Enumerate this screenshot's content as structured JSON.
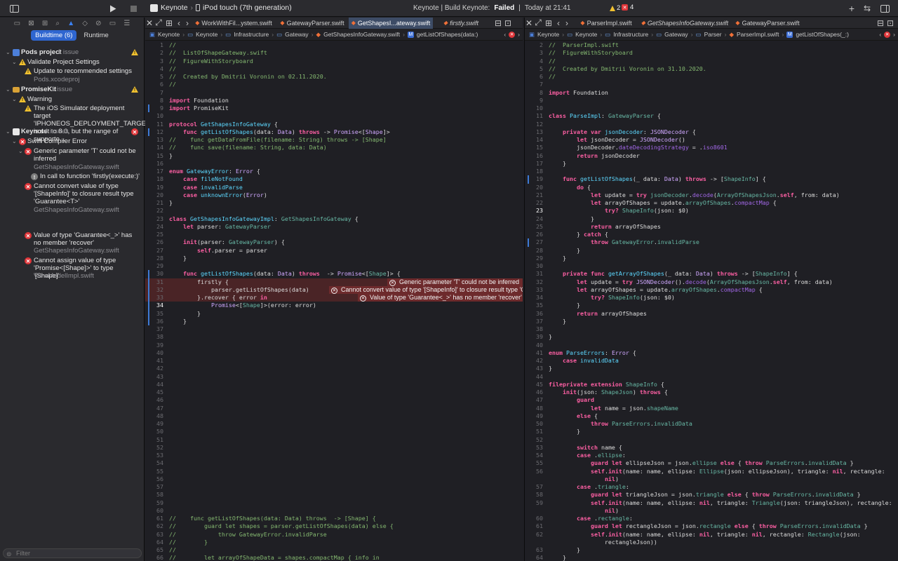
{
  "toolbar": {
    "scheme": "Keynote",
    "device": "iPod touch (7th generation)",
    "status_prefix": "Keynote | Build Keynote:",
    "status_result": "Failed",
    "status_time": "Today at 21:41",
    "warning_count": "2",
    "error_count": "4"
  },
  "navigator": {
    "segments": [
      "Buildtime (6)",
      "Runtime"
    ],
    "filter_placeholder": "Filter",
    "items": {
      "pods_title": "Pods project",
      "pods_count": "1 issue",
      "pods_group": "Validate Project Settings",
      "pods_issue": "Update to recommended settings",
      "pods_file": "Pods.xcodeproj",
      "promise_title": "PromiseKit",
      "promise_count": "1 issue",
      "promise_group": "Warning",
      "promise_issue": "The iOS Simulator deployment target 'IPHONEOS_DEPLOYMENT_TARGET' is set to 8.0, but the range of supporte...",
      "keynote_title": "Keynote",
      "keynote_count": "4 issues",
      "keynote_group": "Swift Compiler Error",
      "err1": "Generic parameter 'T' could not be inferred",
      "err1_file": "GetShapesInfoGateway.swift",
      "note1": "In call to function 'firstly(execute:)'",
      "err2": "Cannot convert value of type '[ShapeInfo]' to closure result type 'Guarantee<T>'",
      "err2_file": "GetShapesInfoGateway.swift",
      "err3": "Value of type 'Guarantee<_>' has no member 'recover'",
      "err3_file": "GetShapesInfoGateway.swift",
      "err4": "Cannot assign value of type 'Promise<[Shape]>' to type '[Shape]'",
      "err4_file": "ViewModelImpl.swift"
    }
  },
  "left_editor": {
    "tabs": [
      "WorkWithFil...ystem.swift",
      "GatewayParser.swift",
      "GetShapesI...ateway.swift",
      "firstly.swift"
    ],
    "active_tab": "GetShapesI...ateway.swift",
    "breadcrumb": [
      "Keynote",
      "Keynote",
      "Infrastructure",
      "Gateway",
      "GetShapesInfoGateway.swift",
      "getListOfShapes(data:)"
    ],
    "inline_errors": [
      "Generic parameter 'T' could not be inferred",
      "Cannot convert value of type '[ShapeInfo]' to closure result type 'Gu...",
      "Value of type 'Guarantee<_>' has no member 'recover'"
    ]
  },
  "right_editor": {
    "tabs": [
      "ParserImpl.swift",
      "GetShapesInfoGateway.swift",
      "GatewayParser.swift"
    ],
    "active_tab": "ParserImpl.swift",
    "breadcrumb": [
      "Keynote",
      "Keynote",
      "Infrastructure",
      "Gateway",
      "Parser",
      "ParserImpl.swift",
      "getListOfShapes(_:)"
    ]
  },
  "left_code": [
    {
      "n": "1",
      "html": "<span class='cmt'>//</span>"
    },
    {
      "n": "2",
      "html": "<span class='cmt'>//  ListOfShapeGateway.swift</span>"
    },
    {
      "n": "3",
      "html": "<span class='cmt'>//  FigureWithStoryboard</span>"
    },
    {
      "n": "4",
      "html": "<span class='cmt'>//</span>"
    },
    {
      "n": "5",
      "html": "<span class='cmt'>//  Created by Dmitrii Voronin on 02.11.2020.</span>"
    },
    {
      "n": "6",
      "html": "<span class='cmt'>//</span>"
    },
    {
      "n": "7",
      "html": ""
    },
    {
      "n": "8",
      "html": "<span class='k'>import</span> Foundation"
    },
    {
      "n": "9",
      "html": "<span class='k'>import</span> PromiseKit"
    },
    {
      "n": "10",
      "html": ""
    },
    {
      "n": "11",
      "html": "<span class='k'>protocol</span> <span class='t'>GetShapesInfoGateway</span> {"
    },
    {
      "n": "12",
      "html": "    <span class='k'>func</span> <span class='t'>getListOfShapes</span>(data: <span class='ty'>Data</span>) <span class='k'>throws</span> -> <span class='ty'>Promise</span>&lt;[<span class='ty'>Shape</span>]&gt;"
    },
    {
      "n": "13",
      "html": "<span class='cmt'>//    func getDataFromFile(filename: String) throws -> [Shape]</span>"
    },
    {
      "n": "14",
      "html": "<span class='cmt'>//    func save(filename: String, data: Data)</span>"
    },
    {
      "n": "15",
      "html": "}"
    },
    {
      "n": "16",
      "html": ""
    },
    {
      "n": "17",
      "html": "<span class='k'>enum</span> <span class='t'>GatewayError</span>: <span class='ty'>Error</span> {"
    },
    {
      "n": "18",
      "html": "    <span class='k'>case</span> <span class='t'>fileNotFound</span>"
    },
    {
      "n": "19",
      "html": "    <span class='k'>case</span> <span class='t'>invalidParse</span>"
    },
    {
      "n": "20",
      "html": "    <span class='k'>case</span> <span class='t'>unknownError</span>(<span class='ty'>Error</span>)"
    },
    {
      "n": "21",
      "html": "}"
    },
    {
      "n": "22",
      "html": ""
    },
    {
      "n": "23",
      "html": "<span class='k'>class</span> <span class='t'>GetShapesInfoGatewayImpl</span>: <span class='f'>GetShapesInfoGateway</span> {"
    },
    {
      "n": "24",
      "html": "    <span class='k'>let</span> parser: <span class='f'>GatewayParser</span>"
    },
    {
      "n": "25",
      "html": ""
    },
    {
      "n": "26",
      "html": "    <span class='k'>init</span>(parser: <span class='f'>GatewayParser</span>) {"
    },
    {
      "n": "27",
      "html": "        <span class='k'>self</span>.parser = parser"
    },
    {
      "n": "28",
      "html": "    }"
    },
    {
      "n": "29",
      "html": ""
    },
    {
      "n": "30",
      "html": "    <span class='k'>func</span> <span class='t'>getListOfShapes</span>(data: <span class='ty'>Data</span>) <span class='k'>throws</span>  -> <span class='ty'>Promise</span>&lt;[<span class='f'>Shape</span>]&gt; {"
    },
    {
      "n": "31",
      "html": "        firstly {"
    },
    {
      "n": "32",
      "html": "            parser.getListOfShapes(data)"
    },
    {
      "n": "33",
      "html": "        }.recover { error <span class='k'>in</span>"
    },
    {
      "n": "34",
      "html": "            <span class='ty'>Promise</span>&lt;[<span class='f'>Shape</span>]&gt;(error: error)"
    },
    {
      "n": "35",
      "html": "        }"
    },
    {
      "n": "36",
      "html": "    }"
    },
    {
      "n": "37",
      "html": ""
    },
    {
      "n": "38",
      "html": ""
    },
    {
      "n": "39",
      "html": ""
    },
    {
      "n": "40",
      "html": ""
    },
    {
      "n": "41",
      "html": ""
    },
    {
      "n": "42",
      "html": ""
    },
    {
      "n": "43",
      "html": ""
    },
    {
      "n": "44",
      "html": ""
    },
    {
      "n": "45",
      "html": ""
    },
    {
      "n": "46",
      "html": ""
    },
    {
      "n": "47",
      "html": ""
    },
    {
      "n": "48",
      "html": ""
    },
    {
      "n": "49",
      "html": ""
    },
    {
      "n": "50",
      "html": ""
    },
    {
      "n": "51",
      "html": ""
    },
    {
      "n": "52",
      "html": ""
    },
    {
      "n": "53",
      "html": ""
    },
    {
      "n": "54",
      "html": ""
    },
    {
      "n": "55",
      "html": ""
    },
    {
      "n": "56",
      "html": ""
    },
    {
      "n": "57",
      "html": ""
    },
    {
      "n": "58",
      "html": ""
    },
    {
      "n": "59",
      "html": ""
    },
    {
      "n": "60",
      "html": ""
    },
    {
      "n": "61",
      "html": "<span class='cmt'>//    func getListOfShapes(data: Data) throws  -> [Shape] {</span>"
    },
    {
      "n": "62",
      "html": "<span class='cmt'>//        guard let shapes = parser.getListOfShapes(data) else {</span>"
    },
    {
      "n": "63",
      "html": "<span class='cmt'>//            throw GatewayError.invalidParse</span>"
    },
    {
      "n": "64",
      "html": "<span class='cmt'>//        }</span>"
    },
    {
      "n": "65",
      "html": "<span class='cmt'>//</span>"
    },
    {
      "n": "66",
      "html": "<span class='cmt'>//        let arrayOfShapeData = shapes.compactMap { info in</span>"
    }
  ],
  "right_code": [
    {
      "n": "2",
      "html": "<span class='cmt'>//  ParserImpl.swift</span>"
    },
    {
      "n": "3",
      "html": "<span class='cmt'>//  FigureWithStoryboard</span>"
    },
    {
      "n": "4",
      "html": "<span class='cmt'>//</span>"
    },
    {
      "n": "5",
      "html": "<span class='cmt'>//  Created by Dmitrii Voronin on 31.10.2020.</span>"
    },
    {
      "n": "6",
      "html": "<span class='cmt'>//</span>"
    },
    {
      "n": "7",
      "html": ""
    },
    {
      "n": "8",
      "html": "<span class='k'>import</span> Foundation"
    },
    {
      "n": "9",
      "html": ""
    },
    {
      "n": "10",
      "html": ""
    },
    {
      "n": "11",
      "html": "<span class='k'>class</span> <span class='t'>ParseImpl</span>: <span class='f'>GatewayParser</span> {"
    },
    {
      "n": "12",
      "html": ""
    },
    {
      "n": "13",
      "html": "    <span class='k'>private var</span> <span class='t'>jsonDecoder</span>: <span class='ty'>JSONDecoder</span> {"
    },
    {
      "n": "14",
      "html": "        <span class='k'>let</span> jsonDecoder = <span class='ty'>JSONDecoder</span>()"
    },
    {
      "n": "15",
      "html": "        jsonDecoder.<span class='m'>dateDecodingStrategy</span> = .<span class='m'>iso8601</span>"
    },
    {
      "n": "16",
      "html": "        <span class='k'>return</span> jsonDecoder"
    },
    {
      "n": "17",
      "html": "    }"
    },
    {
      "n": "18",
      "html": ""
    },
    {
      "n": "19",
      "html": "    <span class='k'>func</span> <span class='t'>getListOfShapes</span>(_ data: <span class='ty'>Data</span>) <span class='k'>throws</span> -> [<span class='f'>ShapeInfo</span>] {"
    },
    {
      "n": "20",
      "html": "        <span class='k'>do</span> {"
    },
    {
      "n": "21",
      "html": "            <span class='k'>let</span> update = <span class='k'>try</span> <span class='f'>jsonDecoder</span>.<span class='m'>decode</span>(<span class='f'>ArrayOfShapesJson</span>.<span class='k'>self</span>, from: data)"
    },
    {
      "n": "22",
      "html": "            <span class='k'>let</span> arrayOfShapes = update.<span class='f'>arrayOfShapes</span>.<span class='m'>compactMap</span> {"
    },
    {
      "n": "23",
      "html": "                <span class='k'>try?</span> <span class='f'>ShapeInfo</span>(json: $0)"
    },
    {
      "n": "24",
      "html": "            }"
    },
    {
      "n": "25",
      "html": "            <span class='k'>return</span> arrayOfShapes"
    },
    {
      "n": "26",
      "html": "        } <span class='k'>catch</span> {"
    },
    {
      "n": "27",
      "html": "            <span class='k'>throw</span> <span class='f'>GatewayError</span>.<span class='f'>invalidParse</span>"
    },
    {
      "n": "28",
      "html": "        }"
    },
    {
      "n": "29",
      "html": "    }"
    },
    {
      "n": "30",
      "html": ""
    },
    {
      "n": "31",
      "html": "    <span class='k'>private func</span> <span class='t'>getArrayOfShapes</span>(_ data: <span class='ty'>Data</span>) <span class='k'>throws</span> -> [<span class='f'>ShapeInfo</span>] {"
    },
    {
      "n": "32",
      "html": "        <span class='k'>let</span> update = <span class='k'>try</span> <span class='ty'>JSONDecoder</span>().<span class='m'>decode</span>(<span class='f'>ArrayOfShapesJson</span>.<span class='k'>self</span>, from: data)"
    },
    {
      "n": "33",
      "html": "        <span class='k'>let</span> arrayOfShapes = update.<span class='f'>arrayOfShapes</span>.<span class='m'>compactMap</span> {"
    },
    {
      "n": "34",
      "html": "            <span class='k'>try?</span> <span class='f'>ShapeInfo</span>(json: $0)"
    },
    {
      "n": "35",
      "html": "        }"
    },
    {
      "n": "36",
      "html": "        <span class='k'>return</span> arrayOfShapes"
    },
    {
      "n": "37",
      "html": "    }"
    },
    {
      "n": "38",
      "html": ""
    },
    {
      "n": "39",
      "html": "}"
    },
    {
      "n": "40",
      "html": ""
    },
    {
      "n": "41",
      "html": "<span class='k'>enum</span> <span class='t'>ParseErrors</span>: <span class='ty'>Error</span> {"
    },
    {
      "n": "42",
      "html": "    <span class='k'>case</span> <span class='t'>invalidData</span>"
    },
    {
      "n": "43",
      "html": "}"
    },
    {
      "n": "44",
      "html": ""
    },
    {
      "n": "45",
      "html": "<span class='k'>fileprivate extension</span> <span class='f'>ShapeInfo</span> {"
    },
    {
      "n": "46",
      "html": "    <span class='k'>init</span>(json: <span class='f'>ShapeJson</span>) <span class='k'>throws</span> {"
    },
    {
      "n": "47",
      "html": "        <span class='k'>guard</span>"
    },
    {
      "n": "48",
      "html": "            <span class='k'>let</span> name = json.<span class='f'>shapeName</span>"
    },
    {
      "n": "49",
      "html": "        <span class='k'>else</span> {"
    },
    {
      "n": "50",
      "html": "            <span class='k'>throw</span> <span class='f'>ParseErrors</span>.<span class='f'>invalidData</span>"
    },
    {
      "n": "51",
      "html": "        }"
    },
    {
      "n": "52",
      "html": ""
    },
    {
      "n": "53",
      "html": "        <span class='k'>switch</span> name {"
    },
    {
      "n": "54",
      "html": "        <span class='k'>case</span> .<span class='f'>ellipse</span>:"
    },
    {
      "n": "55",
      "html": "            <span class='k'>guard let</span> ellipseJson = json.<span class='f'>ellipse</span> <span class='k'>else</span> { <span class='k'>throw</span> <span class='f'>ParseErrors</span>.<span class='f'>invalidData</span> }"
    },
    {
      "n": "56",
      "html": "            <span class='k'>self</span>.<span class='k'>init</span>(name: name, ellipse: <span class='f'>Ellipse</span>(json: ellipseJson), triangle: <span class='k'>nil</span>, rectangle:"
    },
    {
      "n": "",
      "html": "                <span class='k'>nil</span>)"
    },
    {
      "n": "57",
      "html": "        <span class='k'>case</span> .<span class='f'>triangle</span>:"
    },
    {
      "n": "58",
      "html": "            <span class='k'>guard let</span> triangleJson = json.<span class='f'>triangle</span> <span class='k'>else</span> { <span class='k'>throw</span> <span class='f'>ParseErrors</span>.<span class='f'>invalidData</span> }"
    },
    {
      "n": "59",
      "html": "            <span class='k'>self</span>.<span class='k'>init</span>(name: name, ellipse: <span class='k'>nil</span>, triangle: <span class='f'>Triangle</span>(json: triangleJson), rectangle:"
    },
    {
      "n": "",
      "html": "                <span class='k'>nil</span>)"
    },
    {
      "n": "60",
      "html": "        <span class='k'>case</span> .<span class='f'>rectangle</span>:"
    },
    {
      "n": "61",
      "html": "            <span class='k'>guard let</span> rectangleJson = json.<span class='f'>rectangle</span> <span class='k'>else</span> { <span class='k'>throw</span> <span class='f'>ParseErrors</span>.<span class='f'>invalidData</span> }"
    },
    {
      "n": "62",
      "html": "            <span class='k'>self</span>.<span class='k'>init</span>(name: name, ellipse: <span class='k'>nil</span>, triangle: <span class='k'>nil</span>, rectangle: <span class='f'>Rectangle</span>(json:"
    },
    {
      "n": "",
      "html": "                rectangleJson))"
    },
    {
      "n": "63",
      "html": "        }"
    },
    {
      "n": "64",
      "html": "    }"
    }
  ]
}
